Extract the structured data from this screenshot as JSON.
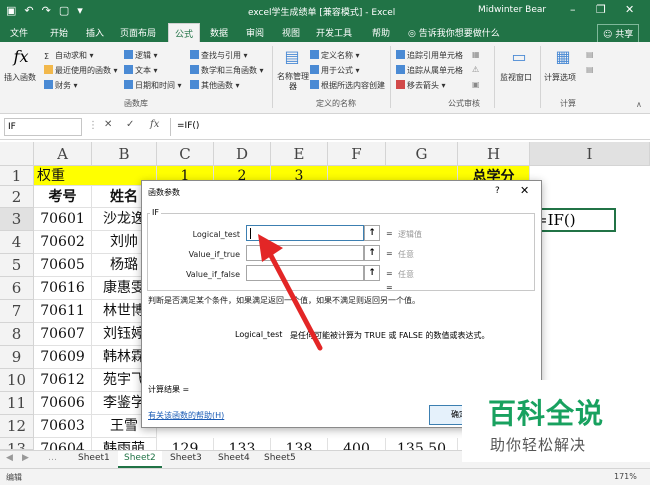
{
  "titlebar": {
    "title": "excel学生成绩单 [兼容模式] - Excel",
    "user": "Midwinter Bear",
    "qat_icons": [
      "save-icon",
      "undo-icon",
      "redo-icon",
      "new-file-icon",
      "customize-icon"
    ],
    "min": "–",
    "restore": "❐",
    "close": "✕"
  },
  "tabs": [
    "文件",
    "开始",
    "插入",
    "页面布局",
    "公式",
    "数据",
    "审阅",
    "视图",
    "开发工具",
    "帮助"
  ],
  "active_tab": "公式",
  "tell_me": "告诉我你想要做什么",
  "share": "共享",
  "ribbon": {
    "insert_function": "插入函数",
    "autosum": "自动求和",
    "recent": "最近使用的函数",
    "finance": "财务",
    "logical": "逻辑",
    "text": "文本",
    "datetime": "日期和时间",
    "lookup": "查找与引用",
    "math": "数学和三角函数",
    "other": "其他函数",
    "group_library": "函数库",
    "name_manager": "名称管理器",
    "define_name": "定义名称",
    "use_in_formula": "用于公式",
    "create_from_selection": "根据所选内容创建",
    "group_names": "定义的名称",
    "trace_precedents": "追踪引用单元格",
    "trace_dependents": "追踪从属单元格",
    "remove_arrows": "移去箭头",
    "group_audit": "公式审核",
    "watch_window": "监视窗口",
    "calc_options": "计算选项",
    "group_calc": "计算"
  },
  "formulabar": {
    "name_box": "IF",
    "cancel": "✕",
    "enter": "✓",
    "fx": "fx",
    "formula": "=IF()"
  },
  "grid": {
    "columns": [
      "A",
      "B",
      "C",
      "D",
      "E",
      "F",
      "G",
      "H",
      "I"
    ],
    "rows": [
      "1",
      "2",
      "3",
      "4",
      "5",
      "6",
      "7",
      "8",
      "9",
      "10",
      "11",
      "12",
      "13"
    ],
    "r1": {
      "a": "权重",
      "c": "1",
      "d": "2",
      "e": "3",
      "h": "总学分"
    },
    "r2": {
      "a": "考号",
      "b": "姓名"
    },
    "data": [
      {
        "a": "70601",
        "b": "沙龙逸"
      },
      {
        "a": "70602",
        "b": "刘帅"
      },
      {
        "a": "70605",
        "b": "杨璐"
      },
      {
        "a": "70616",
        "b": "康惠雯"
      },
      {
        "a": "70611",
        "b": "林世博"
      },
      {
        "a": "70607",
        "b": "刘钰婷"
      },
      {
        "a": "70609",
        "b": "韩林霖"
      },
      {
        "a": "70612",
        "b": "苑宇飞"
      },
      {
        "a": "70606",
        "b": "李鉴学"
      },
      {
        "a": "70603",
        "b": "王雪"
      },
      {
        "a": "70604",
        "b": "韩雨萌",
        "c": "129",
        "d": "133",
        "e": "138",
        "f": "400",
        "g": "135.50"
      }
    ],
    "active_cell_value": "=IF()"
  },
  "dialog": {
    "title": "函数参数",
    "help_q": "?",
    "close": "✕",
    "function_name": "IF",
    "args": [
      {
        "label": "Logical_test",
        "hint": "逻辑值"
      },
      {
        "label": "Value_if_true",
        "hint": "任意"
      },
      {
        "label": "Value_if_false",
        "hint": "任意"
      }
    ],
    "eq": "=",
    "description": "判断是否满足某个条件，如果满足返回一个值，如果不满足则返回另一个值。",
    "arg_desc_name": "Logical_test",
    "arg_desc": "是任何可能被计算为 TRUE 或 FALSE 的数值或表达式。",
    "result": "计算结果 =",
    "help_link": "有关该函数的帮助(H)",
    "ok": "确定"
  },
  "sheets": [
    "Sheet1",
    "Sheet2",
    "Sheet3",
    "Sheet4",
    "Sheet5"
  ],
  "active_sheet": "Sheet2",
  "status": {
    "mode": "编辑",
    "zoom": "171%"
  },
  "watermark": {
    "main": "百科全说",
    "sub": "助你轻松解决"
  },
  "colors": {
    "excel_green": "#217346",
    "highlight_yellow": "#ffff00",
    "arrow_red": "#e32626",
    "watermark_green": "#18a15f"
  }
}
